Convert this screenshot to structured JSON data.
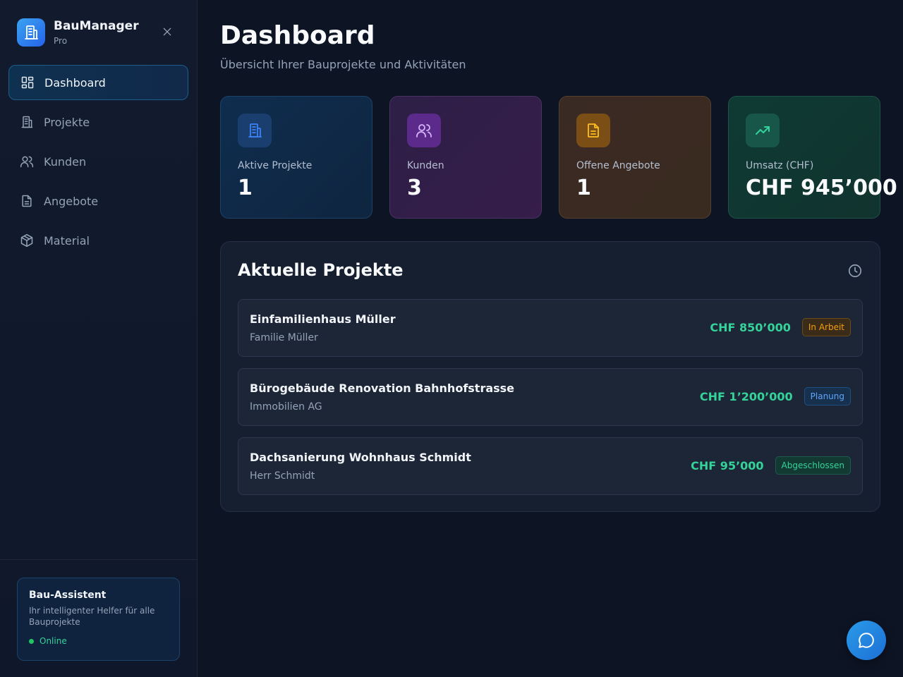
{
  "brand": {
    "name": "BauManager",
    "subtitle": "Pro"
  },
  "nav": [
    {
      "label": "Dashboard",
      "icon": "dashboard-icon",
      "active": true
    },
    {
      "label": "Projekte",
      "icon": "building-icon"
    },
    {
      "label": "Kunden",
      "icon": "users-icon"
    },
    {
      "label": "Angebote",
      "icon": "document-icon"
    },
    {
      "label": "Material",
      "icon": "package-icon"
    }
  ],
  "assistant": {
    "title": "Bau-Assistent",
    "description": "Ihr intelligenter Helfer für alle Bauprojekte",
    "status": "Online"
  },
  "header": {
    "title": "Dashboard",
    "subtitle": "Übersicht Ihrer Bauprojekte und Aktivitäten"
  },
  "stats": [
    {
      "label": "Aktive Projekte",
      "value": "1",
      "icon": "building-icon",
      "color": "#3b82f6"
    },
    {
      "label": "Kunden",
      "value": "3",
      "icon": "users-icon",
      "color": "#c084fc"
    },
    {
      "label": "Offene Angebote",
      "value": "1",
      "icon": "document-icon",
      "color": "#f59e0b"
    },
    {
      "label": "Umsatz (CHF)",
      "value": "CHF 945’000",
      "icon": "trending-up-icon",
      "color": "#34d399"
    }
  ],
  "projects": {
    "title": "Aktuelle Projekte",
    "items": [
      {
        "name": "Einfamilienhaus Müller",
        "client": "Familie Müller",
        "amount": "CHF 850’000",
        "status": "In Arbeit"
      },
      {
        "name": "Bürogebäude Renovation Bahnhofstrasse",
        "client": "Immobilien AG",
        "amount": "CHF 1’200’000",
        "status": "Planung"
      },
      {
        "name": "Dachsanierung Wohnhaus Schmidt",
        "client": "Herr Schmidt",
        "amount": "CHF 95’000",
        "status": "Abgeschlossen"
      }
    ]
  },
  "colors": {
    "accent": "#3ba3f0",
    "success": "#34d399",
    "warning": "#f59e0b",
    "info": "#60a5fa"
  }
}
